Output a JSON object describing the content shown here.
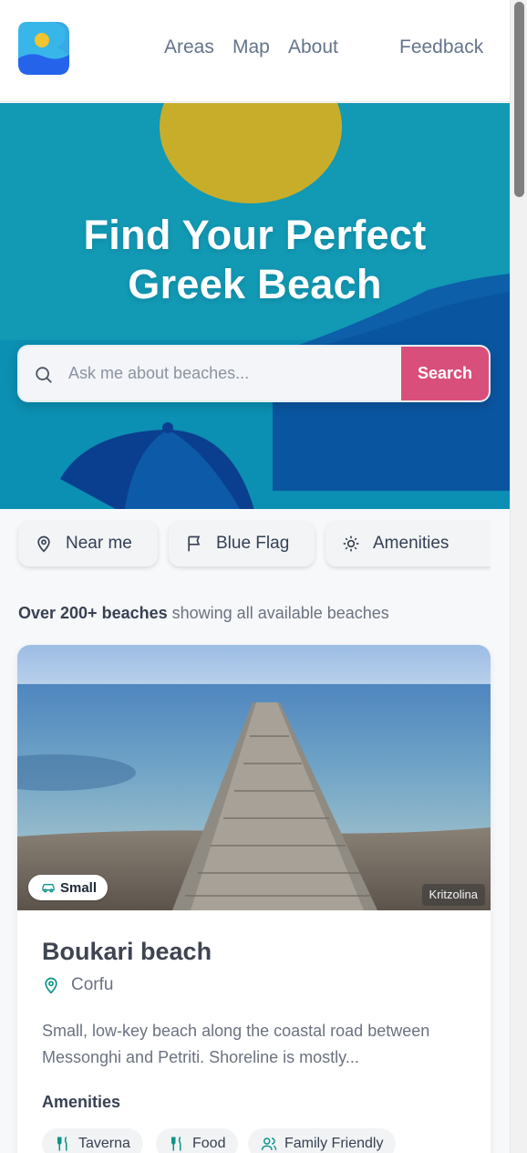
{
  "header": {
    "logo_icon": "beach-logo-icon",
    "nav": {
      "areas": "Areas",
      "map": "Map",
      "about": "About",
      "feedback": "Feedback"
    }
  },
  "hero": {
    "title_line1": "Find Your Perfect",
    "title_line2": "Greek Beach",
    "search": {
      "placeholder": "Ask me about beaches...",
      "value": "",
      "button": "Search"
    }
  },
  "filters": [
    {
      "label": "Near me",
      "icon": "map-pin-icon"
    },
    {
      "label": "Blue Flag",
      "icon": "flag-icon"
    },
    {
      "label": "Amenities",
      "icon": "sun-icon"
    }
  ],
  "results": {
    "count_label": "Over 200+ beaches",
    "status": "showing all available beaches"
  },
  "beach_card": {
    "size_badge": "Small",
    "location_badge": "Kritzolina",
    "title": "Boukari beach",
    "region": "Corfu",
    "description": "Small, low-key beach along the coastal road between Messonghi and Petriti. Shoreline is mostly...",
    "amenities_title": "Amenities",
    "amenities": [
      "Taverna",
      "Food",
      "Family Friendly"
    ]
  },
  "colors": {
    "hero_bg": "#1299b4",
    "sun": "#c8ad2a",
    "search_button": "#d94f7c",
    "accent_teal": "#0e9488"
  }
}
